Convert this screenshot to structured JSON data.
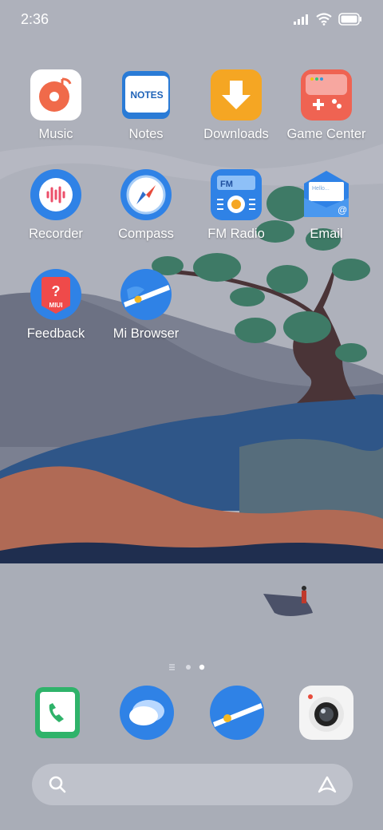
{
  "status_bar": {
    "time": "2:36",
    "icons": [
      "signal-icon",
      "wifi-icon",
      "battery-icon"
    ]
  },
  "apps": [
    {
      "label": "Music",
      "icon": "music-app-icon"
    },
    {
      "label": "Notes",
      "icon": "notes-app-icon",
      "icon_text": "NOTES"
    },
    {
      "label": "Downloads",
      "icon": "downloads-app-icon"
    },
    {
      "label": "Game Center",
      "icon": "game-center-app-icon"
    },
    {
      "label": "Recorder",
      "icon": "recorder-app-icon"
    },
    {
      "label": "Compass",
      "icon": "compass-app-icon"
    },
    {
      "label": "FM Radio",
      "icon": "fm-radio-app-icon",
      "icon_text": "FM"
    },
    {
      "label": "Email",
      "icon": "email-app-icon",
      "icon_text": "Hello..."
    },
    {
      "label": "Feedback",
      "icon": "feedback-app-icon",
      "icon_text": "MIUI"
    },
    {
      "label": "Mi Browser",
      "icon": "mi-browser-app-icon"
    }
  ],
  "page_indicator": {
    "pages": 3,
    "current": 3
  },
  "dock": [
    {
      "icon": "phone-app-icon"
    },
    {
      "icon": "messages-app-icon"
    },
    {
      "icon": "browser-app-icon"
    },
    {
      "icon": "camera-app-icon"
    }
  ],
  "search_bar": {
    "icons": [
      "search-icon",
      "app-vault-icon"
    ]
  },
  "colors": {
    "sky": "#a9adb8",
    "water_blue": "#2f5688",
    "hill_orange": "#b06a55",
    "tree_green": "#3e7a66",
    "text": "#ffffff"
  }
}
